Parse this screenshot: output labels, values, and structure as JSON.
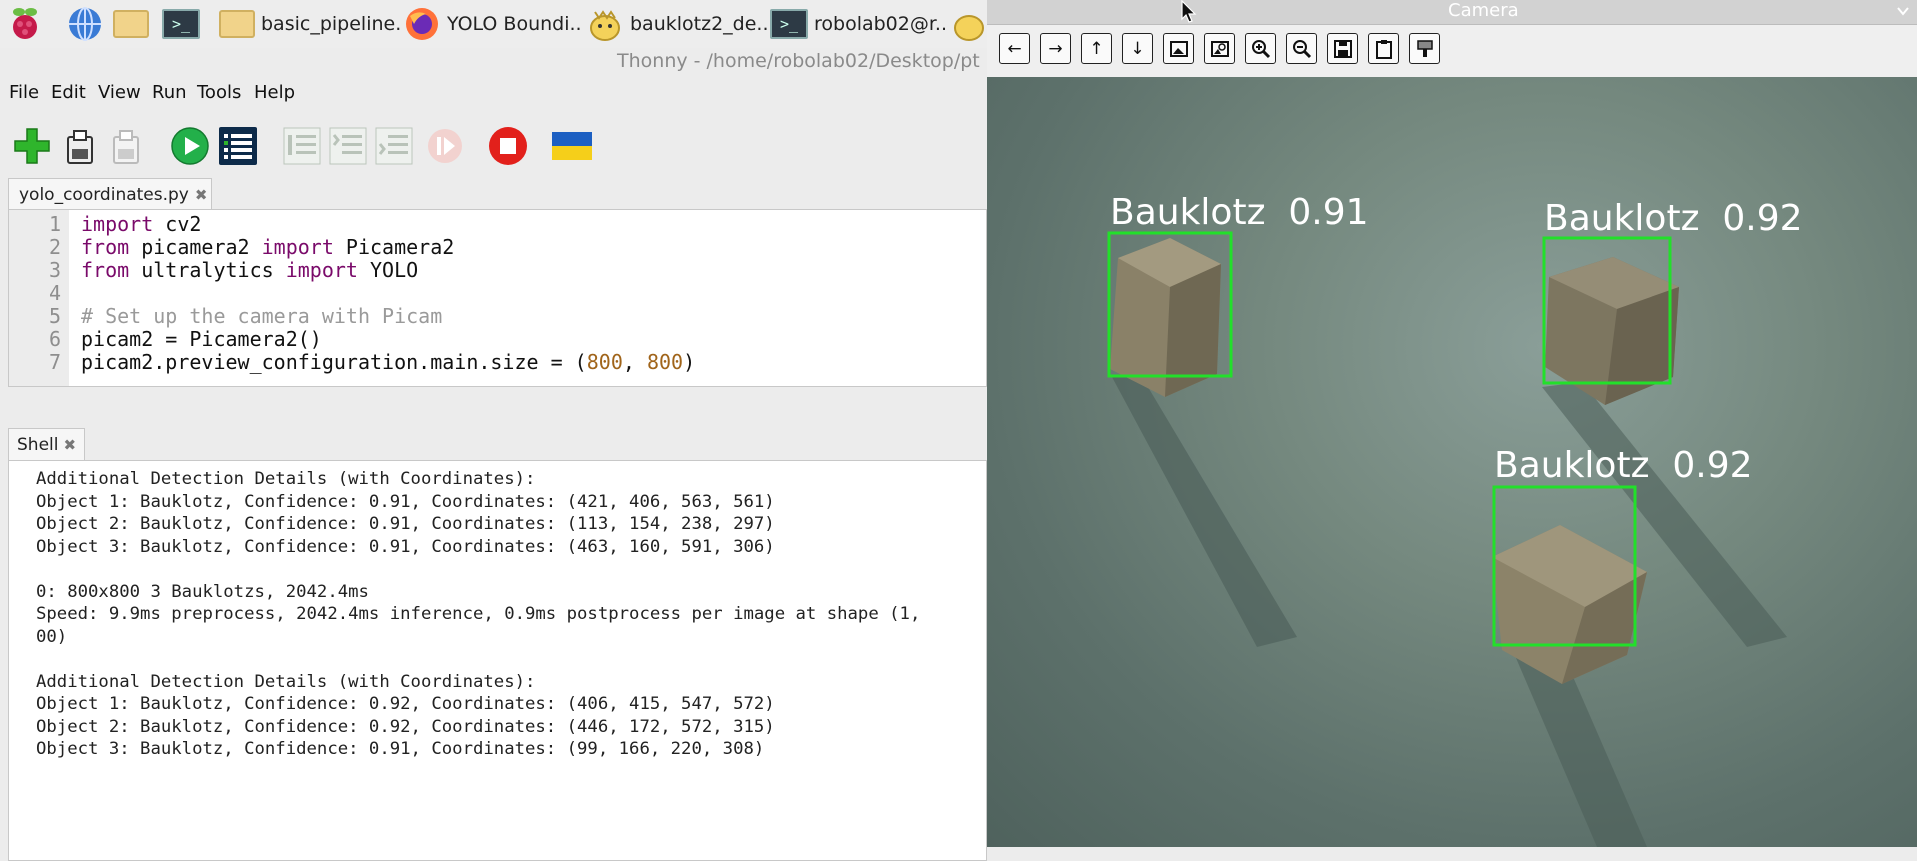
{
  "taskbar": {
    "items": [
      {
        "label": "basic_pipeline."
      },
      {
        "label": "YOLO Boundi.."
      },
      {
        "label": "bauklotz2_de.."
      },
      {
        "label": "robolab02@r.."
      }
    ]
  },
  "thonny": {
    "title": "Thonny  -  /home/robolab02/Desktop/pt m",
    "menu": [
      "File",
      "Edit",
      "View",
      "Run",
      "Tools",
      "Help"
    ],
    "editor_tab": "yolo_coordinates.py",
    "line_numbers": [
      "1",
      "2",
      "3",
      "4",
      "5",
      "6",
      "7"
    ],
    "code": {
      "l1_kw": "import",
      "l1_rest": " cv2",
      "l2_kw1": "from",
      "l2_mid": " picamera2 ",
      "l2_kw2": "import",
      "l2_rest": " Picamera2",
      "l3_kw1": "from",
      "l3_mid": " ultralytics ",
      "l3_kw2": "import",
      "l3_rest": " YOLO",
      "l5_comment": "# Set up the camera with Picam",
      "l6": "picam2 = Picamera2()",
      "l7_pre": "picam2.preview_configuration.main.size = (",
      "l7_n1": "800",
      "l7_sep": ", ",
      "l7_n2": "800",
      "l7_post": ")"
    },
    "shell_tab": "Shell",
    "shell_lines": [
      "Additional Detection Details (with Coordinates):",
      "Object 1: Bauklotz, Confidence: 0.91, Coordinates: (421, 406, 563, 561)",
      "Object 2: Bauklotz, Confidence: 0.91, Coordinates: (113, 154, 238, 297)",
      "Object 3: Bauklotz, Confidence: 0.91, Coordinates: (463, 160, 591, 306)",
      "",
      "0: 800x800 3 Bauklotzs, 2042.4ms",
      "Speed: 9.9ms preprocess, 2042.4ms inference, 0.9ms postprocess per image at shape (1,",
      "00)",
      "",
      "Additional Detection Details (with Coordinates):",
      "Object 1: Bauklotz, Confidence: 0.92, Coordinates: (406, 415, 547, 572)",
      "Object 2: Bauklotz, Confidence: 0.92, Coordinates: (446, 172, 572, 315)",
      "Object 3: Bauklotz, Confidence: 0.91, Coordinates: (99, 166, 220, 308)"
    ]
  },
  "camera": {
    "title": "Camera",
    "detections": [
      {
        "label": "Bauklotz  0.91"
      },
      {
        "label": "Bauklotz  0.92"
      },
      {
        "label": "Bauklotz  0.92"
      }
    ],
    "box_color": "#22e02a"
  }
}
